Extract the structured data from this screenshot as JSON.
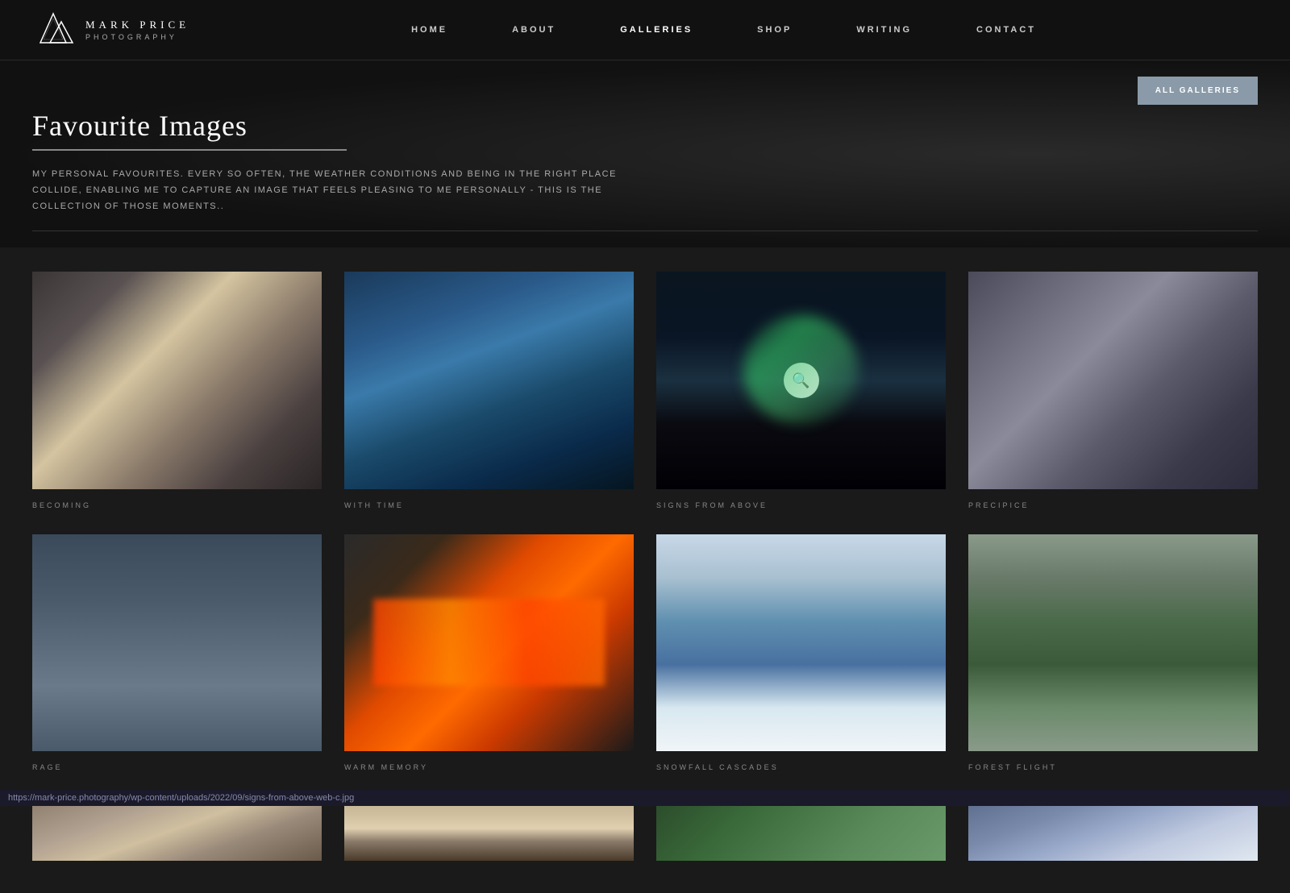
{
  "site": {
    "name": "MARK PRICE",
    "subtitle": "PHOTOGRAPHY",
    "logo_alt": "mountain-logo"
  },
  "nav": {
    "links": [
      {
        "label": "HOME",
        "href": "#",
        "active": false
      },
      {
        "label": "ABOUT",
        "href": "#",
        "active": false
      },
      {
        "label": "GALLERIES",
        "href": "#",
        "active": true
      },
      {
        "label": "SHOP",
        "href": "#",
        "active": false
      },
      {
        "label": "WRITING",
        "href": "#",
        "active": false
      },
      {
        "label": "CONTACT",
        "href": "#",
        "active": false
      }
    ]
  },
  "header": {
    "all_galleries_btn": "ALL GALLERIES",
    "title": "Favourite Images",
    "description": "My personal favourites. Every so often, the weather conditions and being in the right place collide, enabling me to capture an image that feels pleasing to me personally - this is the collection of those moments..",
    "zoom_icon": "🔍"
  },
  "gallery": {
    "items": [
      {
        "id": "becoming",
        "caption": "BECOMING",
        "img_class": "img-becoming",
        "hovered": false
      },
      {
        "id": "with-time",
        "caption": "WITH TIME",
        "img_class": "img-with-time",
        "hovered": false
      },
      {
        "id": "signs-from-above",
        "caption": "SIGNS FROM ABOVE",
        "img_class": "img-signs-from-above",
        "hovered": true
      },
      {
        "id": "precipice",
        "caption": "PRECIPICE",
        "img_class": "img-precipice",
        "hovered": false
      },
      {
        "id": "rage",
        "caption": "RAGE",
        "img_class": "img-rage",
        "hovered": false
      },
      {
        "id": "warm-memory",
        "caption": "WARM MEMORY",
        "img_class": "img-warm-memory",
        "hovered": false
      },
      {
        "id": "snowfall-cascades",
        "caption": "SNOWFALL CASCADES",
        "img_class": "img-snowfall-cascades",
        "hovered": false
      },
      {
        "id": "forest-flight",
        "caption": "FOREST FLIGHT",
        "img_class": "img-forest-flight",
        "hovered": false
      },
      {
        "id": "partial1",
        "caption": "",
        "img_class": "img-partial1",
        "hovered": false,
        "partial": true
      },
      {
        "id": "partial2",
        "caption": "",
        "img_class": "img-partial2",
        "hovered": false,
        "partial": true
      },
      {
        "id": "partial3",
        "caption": "",
        "img_class": "img-partial3",
        "hovered": false,
        "partial": true
      },
      {
        "id": "partial4",
        "caption": "",
        "img_class": "img-partial4",
        "hovered": false,
        "partial": true
      }
    ]
  },
  "statusbar": {
    "url": "https://mark-price.photography/wp-content/uploads/2022/09/signs-from-above-web-c.jpg"
  },
  "colors": {
    "background": "#1a1a1a",
    "nav_bg": "#111111",
    "accent_btn": "#8a9aa8",
    "text_primary": "#ffffff",
    "text_muted": "#aaaaaa",
    "caption_color": "#888888"
  }
}
